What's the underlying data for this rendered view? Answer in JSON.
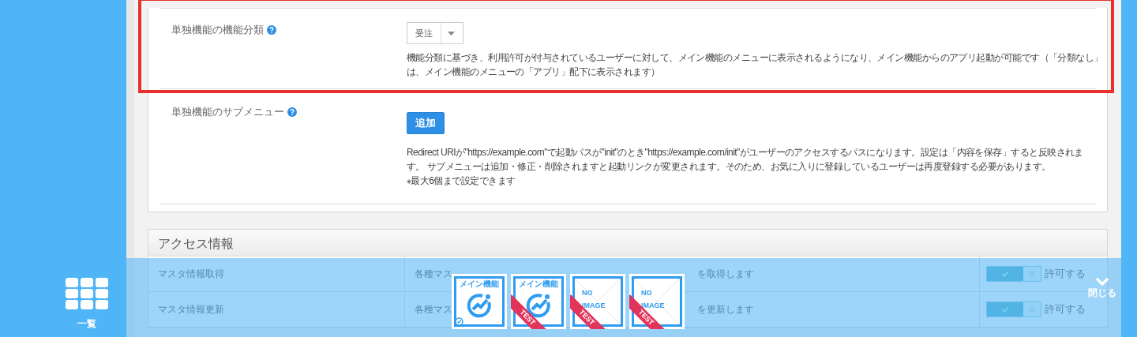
{
  "form_rows": [
    {
      "label": "単独機能の機能分類",
      "kind": "select",
      "highlighted": true,
      "value": "受注",
      "help_lines": [
        "機能分類に基づき、利用許可が付与されているユーザーに対して、メイン機能のメニューに表示されるようになり、メイン機能からのアプリ起動が可能です（「分類なし」",
        "は、メイン機能のメニューの「アプリ」配下に表示されます）"
      ]
    },
    {
      "label": "単独機能のサブメニュー",
      "kind": "button",
      "highlighted": false,
      "value": "追加",
      "help_lines": [
        "Redirect URIが\"https://example.com\"で起動パスが\"init\"のとき\"https://example.com/init\"がユーザーのアクセスするパスになります。設定は「内容を保存」すると反映されま",
        "す。 サブメニューは追加・修正・削除されますと起動リンクが変更されます。そのため、お気に入りに登録しているユーザーは再度登録する必要があります。",
        "⁎最大6個まで設定できます"
      ]
    }
  ],
  "access": {
    "title": "アクセス情報",
    "rows": [
      {
        "name": "マスタ情報取得",
        "description_start": "各種マス",
        "description_end": "を取得します",
        "permitted": true,
        "toggle_label": "許可する"
      },
      {
        "name": "マスタ情報更新",
        "description_start": "各種マス",
        "description_end": "を更新します",
        "permitted": true,
        "toggle_label": "許可する"
      }
    ]
  },
  "dock": {
    "menu_button": {
      "label": "一覧"
    },
    "apps": [
      {
        "kind": "app",
        "label": "メイン機能",
        "verified": true
      },
      {
        "kind": "app",
        "label": "メイン機能",
        "badge": "TEST",
        "verified": false
      },
      {
        "kind": "no-image",
        "label": "NO IMAGE",
        "badge": "TEST",
        "verified": false
      },
      {
        "kind": "no-image",
        "label": "NO IMAGE",
        "badge": "TEST",
        "verified": false
      }
    ],
    "close_button": {
      "label": "閉じる"
    }
  }
}
